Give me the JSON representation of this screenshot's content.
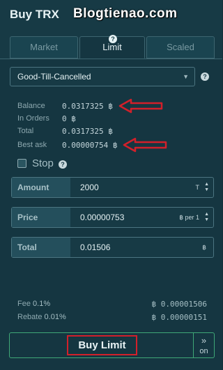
{
  "header": {
    "title": "Buy TRX",
    "watermark": "Blogtienao.com",
    "close_icon": "close-icon"
  },
  "tabs": [
    {
      "label": "Market",
      "active": false
    },
    {
      "label": "Limit",
      "active": true
    },
    {
      "label": "Scaled",
      "active": false
    }
  ],
  "order_type": {
    "selected": "Good-Till-Cancelled"
  },
  "balances": {
    "balance_label": "Balance",
    "balance_value": "0.0317325 ฿",
    "in_orders_label": "In Orders",
    "in_orders_value": "0 ฿",
    "total_label": "Total",
    "total_value": "0.0317325 ฿",
    "best_ask_label": "Best ask",
    "best_ask_value": "0.00000754 ฿"
  },
  "stop": {
    "label": "Stop",
    "checked": false
  },
  "amount": {
    "label": "Amount",
    "value": "2000",
    "unit": "T"
  },
  "price": {
    "label": "Price",
    "value": "0.00000753",
    "unit": "฿ per 1"
  },
  "total": {
    "label": "Total",
    "value": "0.01506",
    "unit": "฿"
  },
  "fees": {
    "fee_label": "Fee",
    "fee_pct": "0.1%",
    "fee_value": "฿ 0.00001506",
    "rebate_label": "Rebate",
    "rebate_pct": "0.01%",
    "rebate_value": "฿ 0.00000151"
  },
  "buy_button": {
    "label": "Buy  Limit"
  },
  "toggle": {
    "label": "on",
    "icon": "double-chevron-right-icon"
  },
  "colors": {
    "accent": "#3fa877",
    "annotation_red": "#d2202a",
    "panel": "#153641"
  }
}
